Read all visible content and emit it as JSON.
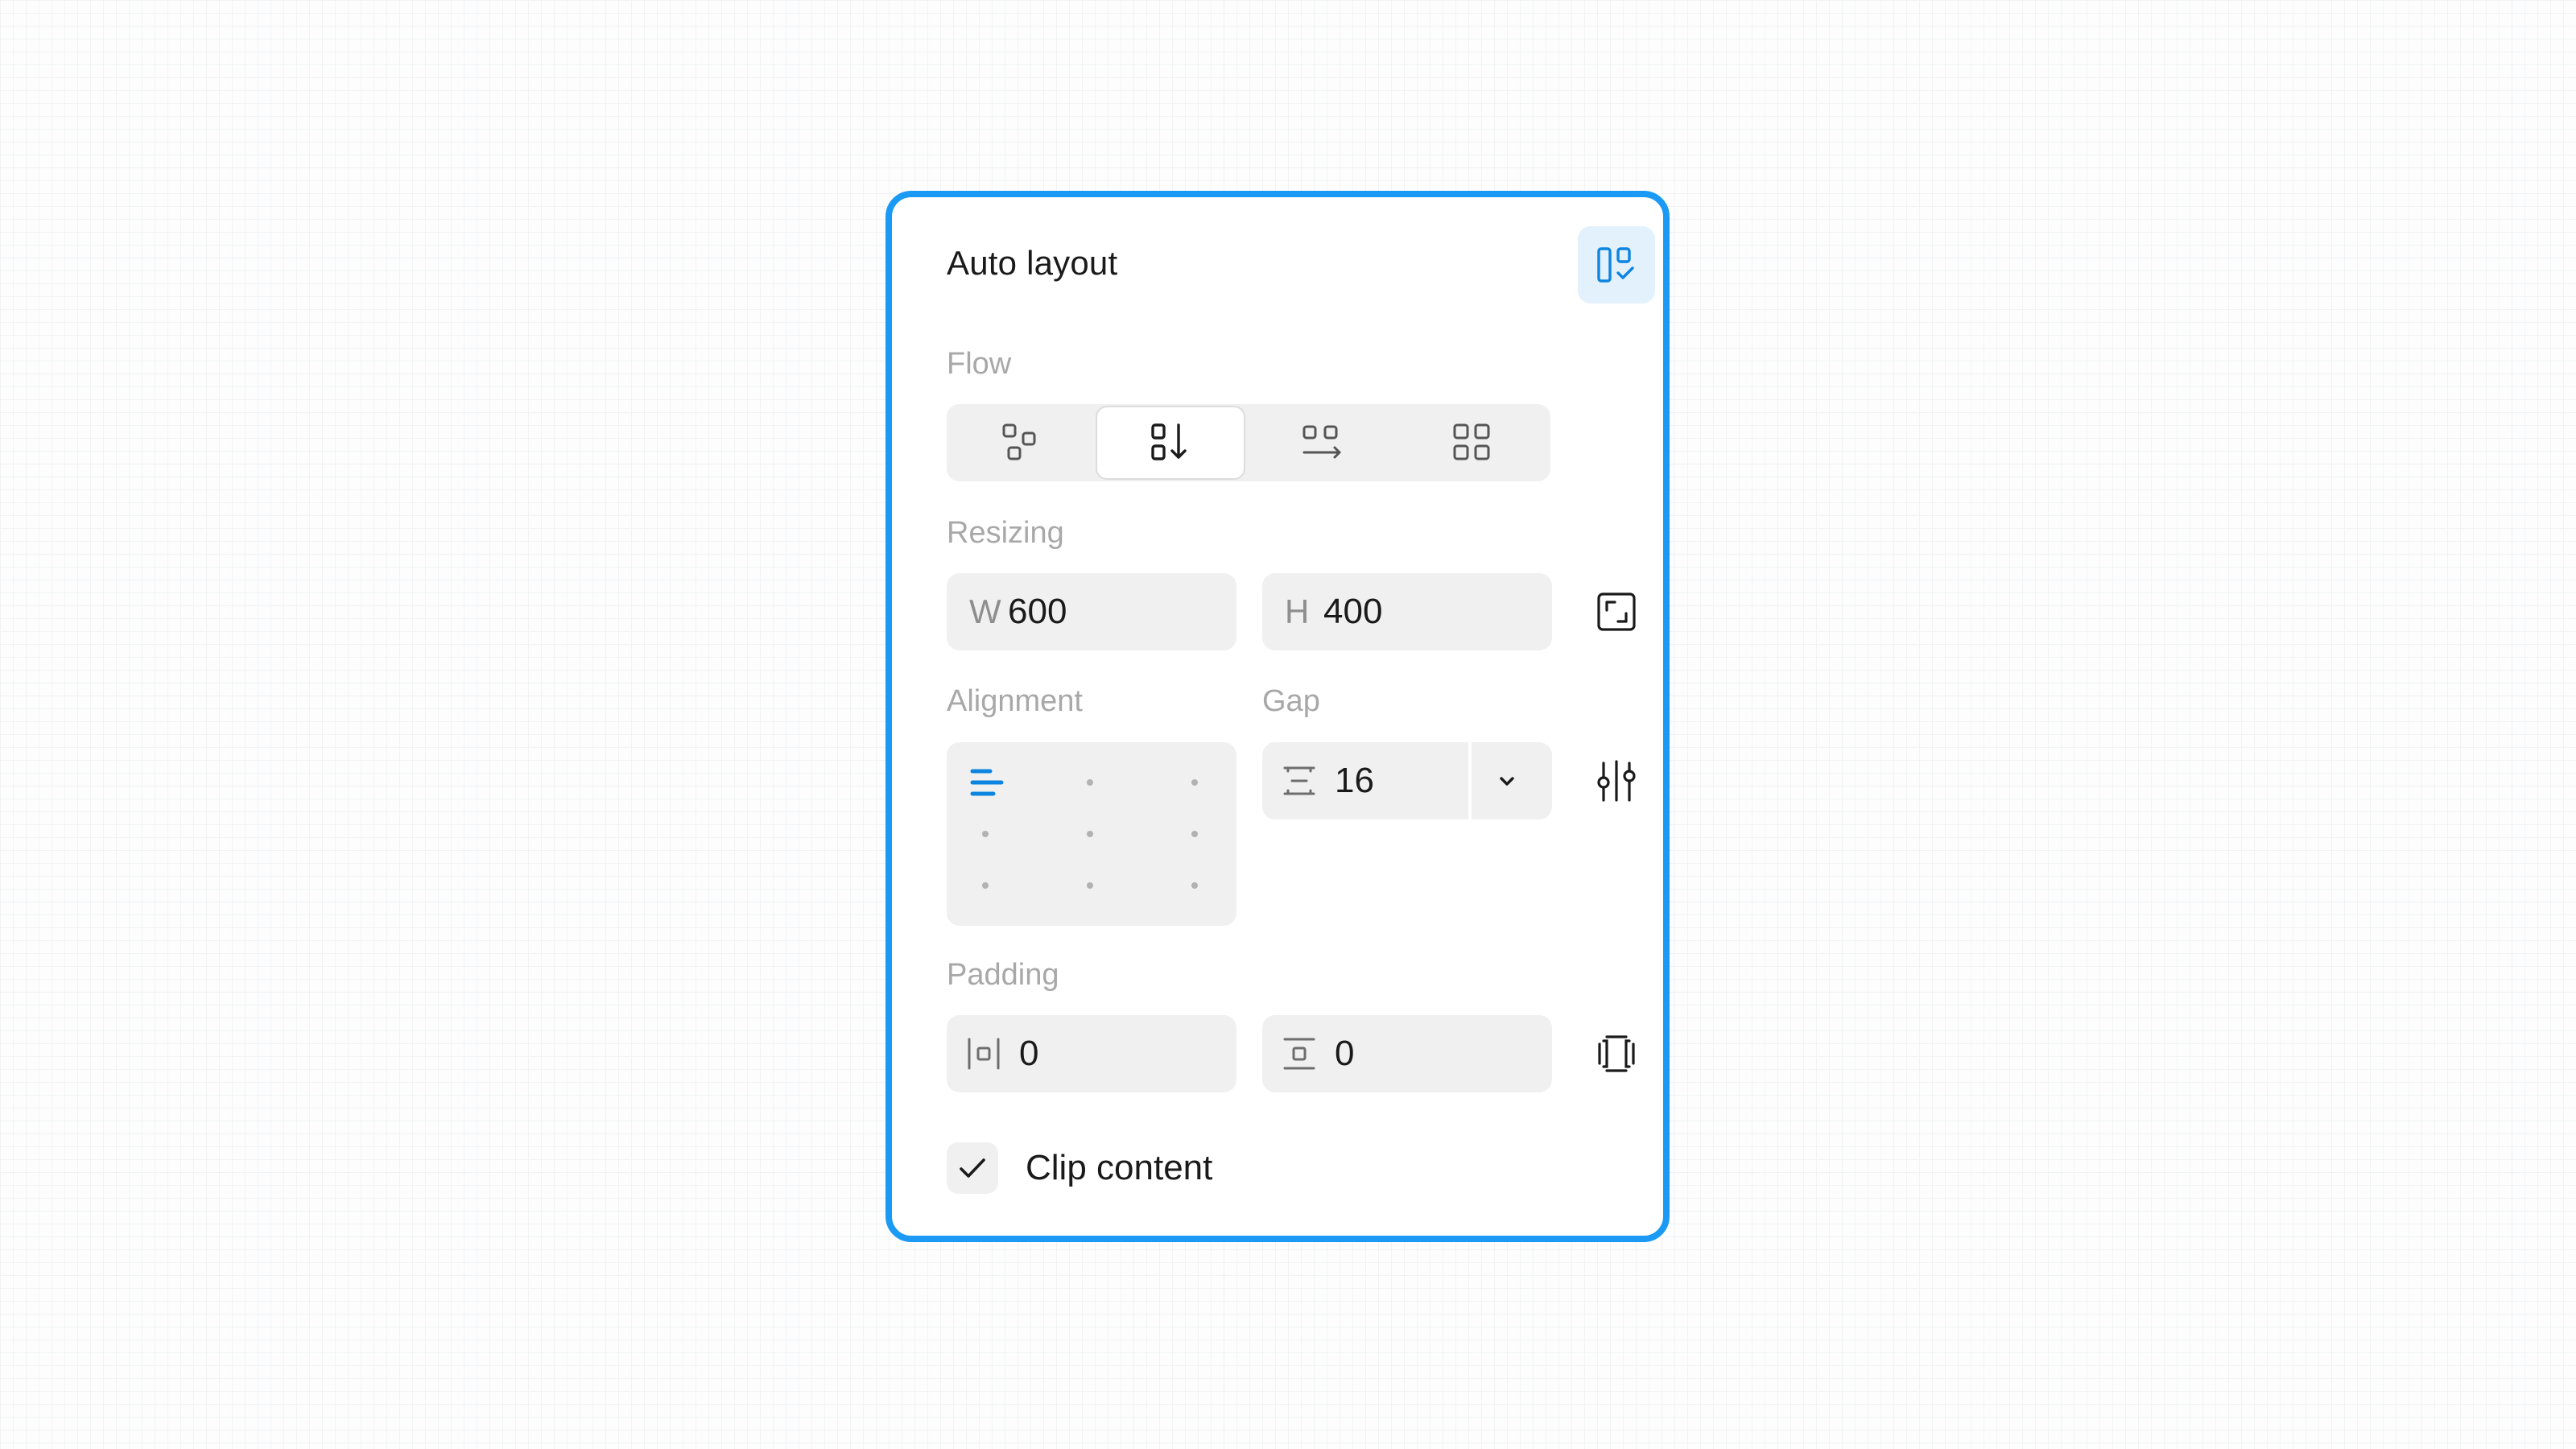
{
  "panel": {
    "title": "Auto layout",
    "layout_icon": "layout-suggest-icon"
  },
  "flow": {
    "label": "Flow",
    "options": [
      {
        "name": "freeform",
        "icon": "flow-freeform-icon",
        "active": false
      },
      {
        "name": "vertical",
        "icon": "flow-vertical-icon",
        "active": true
      },
      {
        "name": "horizontal",
        "icon": "flow-horizontal-icon",
        "active": false
      },
      {
        "name": "grid",
        "icon": "flow-grid-icon",
        "active": false
      }
    ]
  },
  "resizing": {
    "label": "Resizing",
    "width_prefix": "W",
    "width_value": "600",
    "height_prefix": "H",
    "height_value": "400",
    "resize_icon": "resize-to-fit-icon"
  },
  "alignment": {
    "label": "Alignment",
    "selected": "top-left"
  },
  "gap": {
    "label": "Gap",
    "value": "16",
    "gap_icon": "vertical-gap-icon",
    "dropdown_icon": "chevron-down-icon",
    "settings_icon": "advanced-settings-icon"
  },
  "padding": {
    "label": "Padding",
    "horizontal_value": "0",
    "vertical_value": "0",
    "horizontal_icon": "horizontal-padding-icon",
    "vertical_icon": "vertical-padding-icon",
    "individual_icon": "individual-padding-icon"
  },
  "clip": {
    "label": "Clip content",
    "checked": true
  },
  "colors": {
    "accent": "#1b9af5",
    "active_blue": "#0d84e0",
    "field_bg": "#f0f0f0",
    "label_gray": "#a8a8a8"
  }
}
